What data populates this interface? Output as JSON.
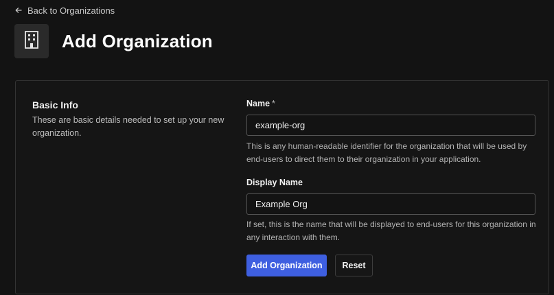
{
  "nav": {
    "back_label": "Back to Organizations",
    "back_icon": "arrow-left-icon"
  },
  "header": {
    "icon": "building-icon",
    "title": "Add Organization"
  },
  "basic_info": {
    "title": "Basic Info",
    "description": "These are basic details needed to set up your new organization."
  },
  "form": {
    "name": {
      "label": "Name",
      "required_marker": "*",
      "value": "example-org",
      "help": "This is any human-readable identifier for the organization that will be used by end-users to direct them to their organization in your application."
    },
    "display_name": {
      "label": "Display Name",
      "value": "Example Org",
      "help": "If set, this is the name that will be displayed to end-users for this organization in any interaction with them."
    }
  },
  "actions": {
    "submit_label": "Add Organization",
    "reset_label": "Reset"
  },
  "colors": {
    "background": "#131313",
    "primary": "#3e5fe0",
    "border": "#555555"
  }
}
